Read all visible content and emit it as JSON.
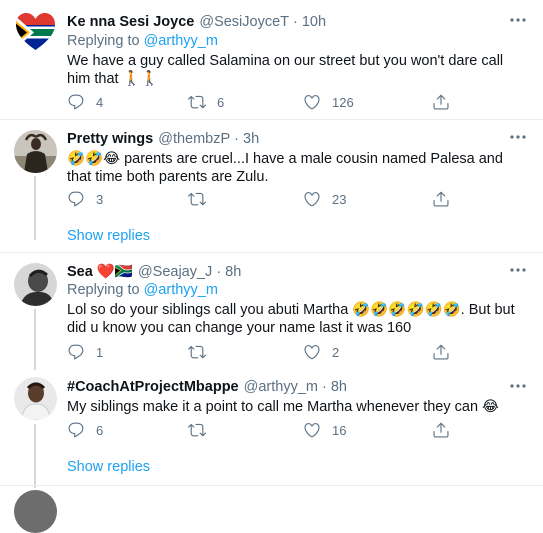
{
  "tweets": [
    {
      "name": "Ke nna Sesi Joyce",
      "handle": "@SesiJoyceT",
      "dot": "·",
      "time": "10h",
      "replying_prefix": "Replying to ",
      "replying_to": "@arthyy_m",
      "text": "We have a guy called Salamina on our street but you won't dare call him that 🚶🚶",
      "reply_count": "4",
      "retweet_count": "6",
      "like_count": "126"
    },
    {
      "name": "Pretty wings",
      "handle": "@thembzP",
      "dot": "·",
      "time": "3h",
      "text": "🤣🤣😂 parents are cruel...I have a male cousin named Palesa and that time both parents are Zulu.",
      "reply_count": "3",
      "retweet_count": "",
      "like_count": "23"
    },
    {
      "name": "Sea ❤️🇿🇦",
      "handle": "@Seajay_J",
      "dot": "·",
      "time": "8h",
      "replying_prefix": "Replying to ",
      "replying_to": "@arthyy_m",
      "text": "Lol so do your siblings call you abuti Martha 🤣🤣🤣🤣🤣🤣. But but did u know you can change your name last it was 160",
      "reply_count": "1",
      "retweet_count": "",
      "like_count": "2"
    },
    {
      "name": "#CoachAtProjectMbappe",
      "handle": "@arthyy_m",
      "dot": "·",
      "time": "8h",
      "text": "My siblings make it a point to call me Martha whenever they can 😂",
      "reply_count": "6",
      "retweet_count": "",
      "like_count": "16"
    }
  ],
  "show_replies": "Show replies",
  "colors": {
    "accent": "#1da1f2",
    "secondary_text": "#5b7083",
    "thread_line": "#cfd9de",
    "divider": "#ebeef0"
  },
  "icons": [
    "more-icon",
    "reply-icon",
    "retweet-icon",
    "like-icon",
    "share-icon"
  ]
}
